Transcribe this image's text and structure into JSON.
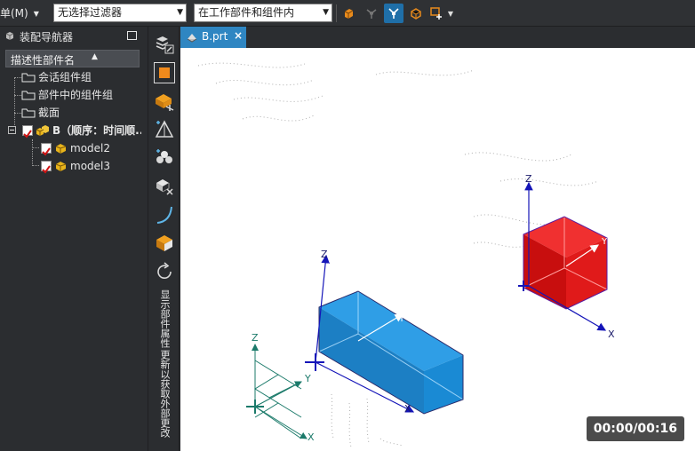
{
  "toolbar": {
    "menu_label": "单(M)",
    "filter_combo": "无选择过滤器",
    "scope_combo": "在工作部件和组件内",
    "icons": [
      "assembly-icon",
      "snap-icon",
      "select-faces-icon",
      "component-select-icon",
      "point-add-icon",
      "dropdown-arrow-icon"
    ]
  },
  "navigator": {
    "title": "装配导航器",
    "column_header": "描述性部件名",
    "items": [
      {
        "label": "会话组件组",
        "icon": "folder-icon",
        "level": 0
      },
      {
        "label": "部件中的组件组",
        "icon": "folder-icon",
        "level": 0
      },
      {
        "label": "截面",
        "icon": "folder-icon",
        "level": 0
      },
      {
        "label": "B（顺序：时间顺...",
        "icon": "assembly-icon",
        "level": 0,
        "checked": true,
        "bold": true
      },
      {
        "label": "model2",
        "icon": "part-icon",
        "level": 1,
        "checked": true
      },
      {
        "label": "model3",
        "icon": "part-icon",
        "level": 1,
        "checked": true
      }
    ]
  },
  "side_strip": {
    "vertical_labels": [
      "显示部件属性",
      "更新以获取外部更改"
    ]
  },
  "document_tab": {
    "label": "B.prt",
    "close": "×"
  },
  "viewport": {
    "axis_labels": {
      "z": "Z",
      "y": "Y",
      "x": "X"
    },
    "objects": [
      {
        "name": "red-cube",
        "color": "#e01010"
      },
      {
        "name": "blue-block",
        "color": "#1a8ad4"
      },
      {
        "name": "wireframe-csys",
        "color": "#1b7a6a"
      }
    ],
    "timer": "00:00/00:16"
  }
}
